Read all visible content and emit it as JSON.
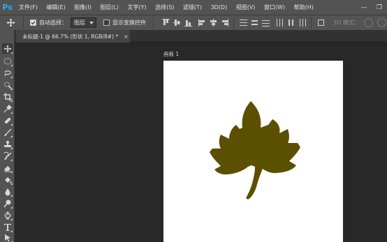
{
  "app": {
    "logo": "Ps"
  },
  "menu": [
    "文件(F)",
    "编辑(E)",
    "图像(I)",
    "图层(L)",
    "文字(Y)",
    "选择(S)",
    "滤镜(T)",
    "3D(D)",
    "视图(V)",
    "窗口(W)",
    "帮助(H)"
  ],
  "window_controls": {
    "minimize": "—",
    "restore": "❐"
  },
  "options": {
    "auto_select_label": "自动选择：",
    "auto_select_checked": true,
    "layer_select_value": "图层",
    "show_transform_label": "显示变换控件",
    "show_transform_checked": false,
    "mode_3d_label": "3D 模式："
  },
  "document": {
    "tab_title": "未标题-1 @ 66.7% (形状 1, RGB/8#) *",
    "close_glyph": "×",
    "artboard_name": "画板 1",
    "shape_color": "#5b4f00"
  },
  "tools": [
    "move-tool",
    "marquee-tool",
    "lasso-tool",
    "quick-select-tool",
    "crop-tool",
    "eyedropper-tool",
    "healing-brush-tool",
    "brush-tool",
    "clone-stamp-tool",
    "history-brush-tool",
    "eraser-tool",
    "paint-bucket-tool",
    "blur-tool",
    "dodge-tool",
    "pen-tool",
    "type-tool",
    "path-selection-tool"
  ]
}
